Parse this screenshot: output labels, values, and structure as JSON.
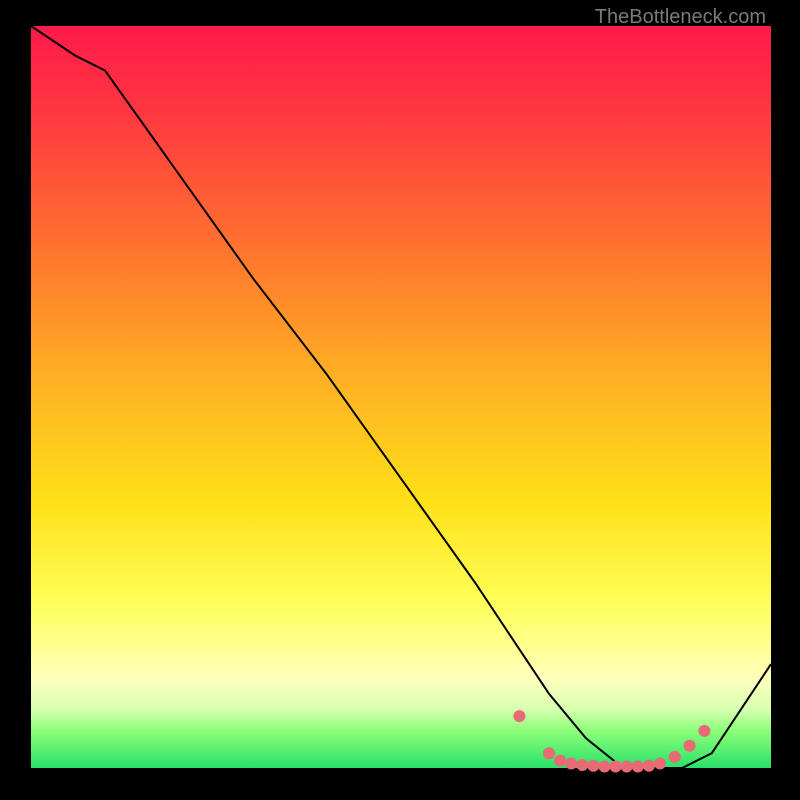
{
  "watermark": "TheBottleneck.com",
  "chart_data": {
    "type": "line",
    "title": "",
    "xlabel": "",
    "ylabel": "",
    "xlim": [
      0,
      100
    ],
    "ylim": [
      0,
      100
    ],
    "series": [
      {
        "name": "bottleneck-curve",
        "x": [
          0,
          6,
          10,
          20,
          30,
          40,
          50,
          60,
          66,
          70,
          75,
          80,
          84,
          88,
          92,
          100
        ],
        "y": [
          100,
          96,
          94,
          80,
          66,
          53,
          39,
          25,
          16,
          10,
          4,
          0,
          0,
          0,
          2,
          14
        ],
        "stroke": "#000000",
        "stroke_width": 2
      }
    ],
    "markers": {
      "name": "flat-region-dots",
      "color": "#e86a75",
      "radius_px": 6,
      "x": [
        66,
        70,
        71.5,
        73,
        74.5,
        76,
        77.5,
        79,
        80.5,
        82,
        83.5,
        85,
        87,
        89,
        91
      ],
      "y": [
        7,
        2,
        1,
        0.6,
        0.4,
        0.3,
        0.2,
        0.2,
        0.2,
        0.2,
        0.3,
        0.6,
        1.5,
        3,
        5
      ]
    },
    "gradient_stops": [
      {
        "pos": 0.0,
        "color": "#ff1a49"
      },
      {
        "pos": 0.12,
        "color": "#ff3840"
      },
      {
        "pos": 0.32,
        "color": "#ff7a2c"
      },
      {
        "pos": 0.48,
        "color": "#ffb224"
      },
      {
        "pos": 0.64,
        "color": "#ffe018"
      },
      {
        "pos": 0.78,
        "color": "#ffff5a"
      },
      {
        "pos": 0.88,
        "color": "#ffffbe"
      },
      {
        "pos": 0.92,
        "color": "#d8ffb0"
      },
      {
        "pos": 0.95,
        "color": "#8cff7a"
      },
      {
        "pos": 1.0,
        "color": "#29e06a"
      }
    ]
  }
}
